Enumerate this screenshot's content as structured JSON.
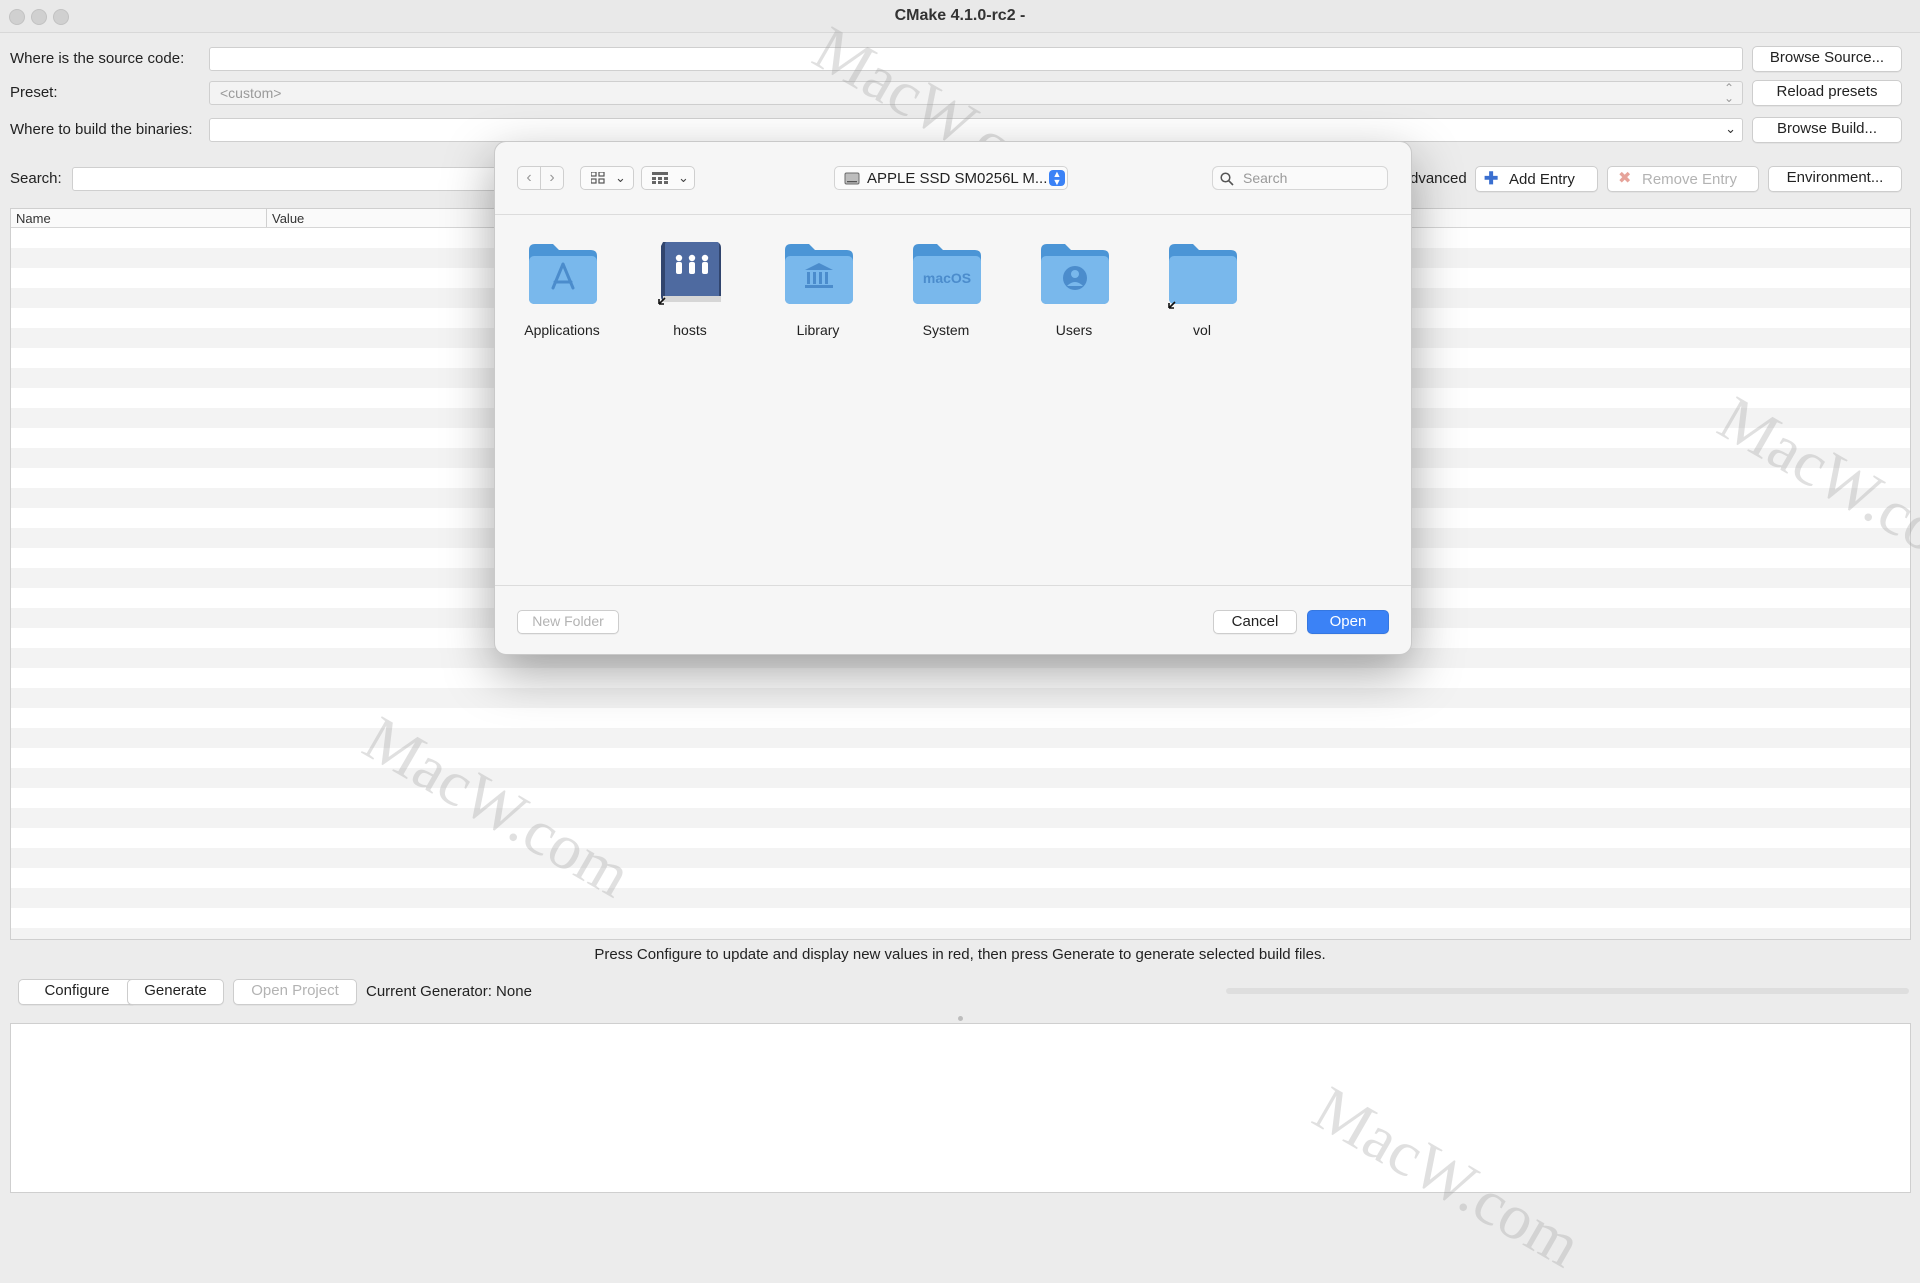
{
  "window": {
    "title": "CMake 4.1.0-rc2 -"
  },
  "source": {
    "label": "Where is the source code:",
    "value": "",
    "browse_label": "Browse Source..."
  },
  "preset": {
    "label": "Preset:",
    "value": "<custom>",
    "reload_label": "Reload presets"
  },
  "build": {
    "label": "Where to build the binaries:",
    "value": "",
    "browse_label": "Browse Build..."
  },
  "search": {
    "label": "Search:",
    "value": ""
  },
  "toolbar": {
    "advanced_label": "dvanced",
    "add_entry_label": "Add Entry",
    "remove_entry_label": "Remove Entry",
    "environment_label": "Environment..."
  },
  "table": {
    "columns": [
      "Name",
      "Value"
    ]
  },
  "status": {
    "hint": "Press Configure to update and display new values in red, then press Generate to generate selected build files.",
    "configure_label": "Configure",
    "generate_label": "Generate",
    "open_project_label": "Open Project",
    "current_generator": "Current Generator: None"
  },
  "dialog": {
    "location": "APPLE SSD SM0256L M...",
    "search_placeholder": "Search",
    "items": [
      {
        "name": "Applications",
        "icon": "applications-folder-icon"
      },
      {
        "name": "hosts",
        "icon": "hosts-alias-icon"
      },
      {
        "name": "Library",
        "icon": "library-folder-icon"
      },
      {
        "name": "System",
        "icon": "system-folder-icon",
        "badge": "macOS"
      },
      {
        "name": "Users",
        "icon": "users-folder-icon"
      },
      {
        "name": "vol",
        "icon": "vol-alias-folder-icon"
      }
    ],
    "new_folder_label": "New Folder",
    "cancel_label": "Cancel",
    "open_label": "Open"
  },
  "watermark": {
    "text": "MacW.com"
  },
  "colors": {
    "accent": "#3b82f6",
    "folder": "#6aaee6",
    "folder_dark": "#4b95d6"
  }
}
